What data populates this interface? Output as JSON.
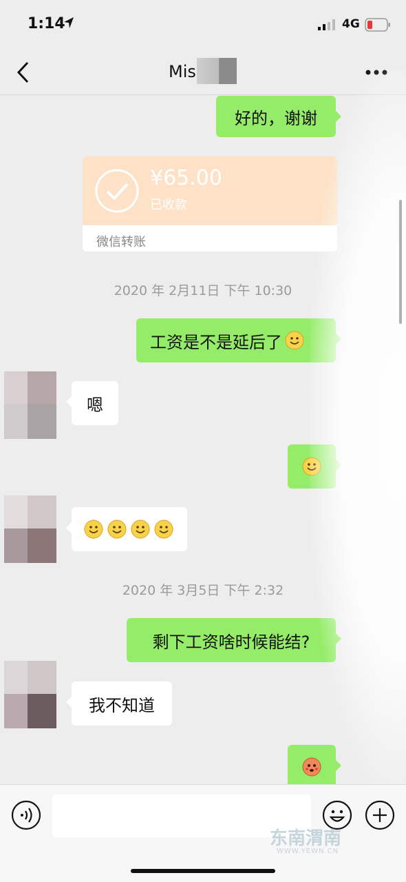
{
  "status_bar": {
    "time": "1:14",
    "network": "4G"
  },
  "nav": {
    "title": "Mis"
  },
  "messages": {
    "m1": "好的，谢谢",
    "transfer": {
      "amount": "¥65.00",
      "status": "已收款",
      "label": "微信转账"
    },
    "ts1": "2020 年 2月11日 下午 10:30",
    "m2": "工资是不是延后了",
    "m3": "嗯",
    "ts2": "2020 年 3月5日 下午 2:32",
    "m4": "剩下工资啥时候能结?",
    "m5": "我不知道"
  },
  "watermark": {
    "text": "东南渭南",
    "url": "WWW.YEWN.CN"
  },
  "colors": {
    "sent_bubble": "#95ec69",
    "received_bubble": "#ffffff",
    "background": "#ededed",
    "transfer_card": "#fde2c8"
  }
}
